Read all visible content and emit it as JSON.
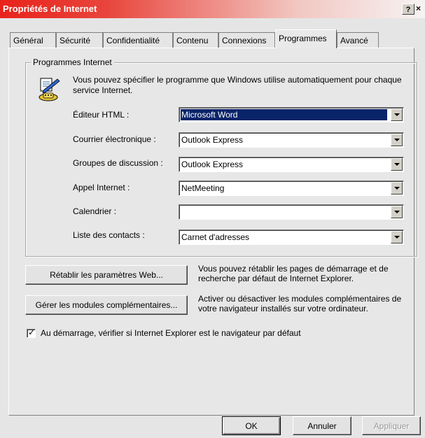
{
  "window": {
    "title": "Propriétés de Internet",
    "help_label": "?",
    "close_label": "×"
  },
  "tabs": [
    {
      "label": "Général"
    },
    {
      "label": "Sécurité"
    },
    {
      "label": "Confidentialité"
    },
    {
      "label": "Contenu"
    },
    {
      "label": "Connexions"
    },
    {
      "label": "Programmes",
      "active": true
    },
    {
      "label": "Avancé"
    }
  ],
  "programs": {
    "group_title": "Programmes Internet",
    "intro": "Vous pouvez spécifier le programme que Windows utilise automatiquement pour chaque service Internet.",
    "rows": [
      {
        "label": "Éditeur HTML :",
        "value": "Microsoft Word",
        "selected": true
      },
      {
        "label": "Courrier électronique :",
        "value": "Outlook Express"
      },
      {
        "label": "Groupes de discussion :",
        "value": "Outlook Express"
      },
      {
        "label": "Appel Internet :",
        "value": "NetMeeting"
      },
      {
        "label": "Calendrier :",
        "value": ""
      },
      {
        "label": "Liste des contacts :",
        "value": "Carnet d'adresses"
      }
    ]
  },
  "reset_web": {
    "button_label": "Rétablir les paramètres Web...",
    "description": "Vous pouvez rétablir les pages de démarrage et de recherche par défaut de Internet Explorer."
  },
  "addons": {
    "button_label": "Gérer les modules complémentaires...",
    "description": "Activer ou désactiver les modules complémentaires de votre navigateur installés sur votre ordinateur."
  },
  "default_check": {
    "checked": true,
    "label": "Au démarrage, vérifier si Internet Explorer est le navigateur par défaut"
  },
  "footer": {
    "ok_label": "OK",
    "cancel_label": "Annuler",
    "apply_label": "Appliquer"
  },
  "icons": {
    "program": "programs-icon",
    "check": "checkmark-icon"
  }
}
